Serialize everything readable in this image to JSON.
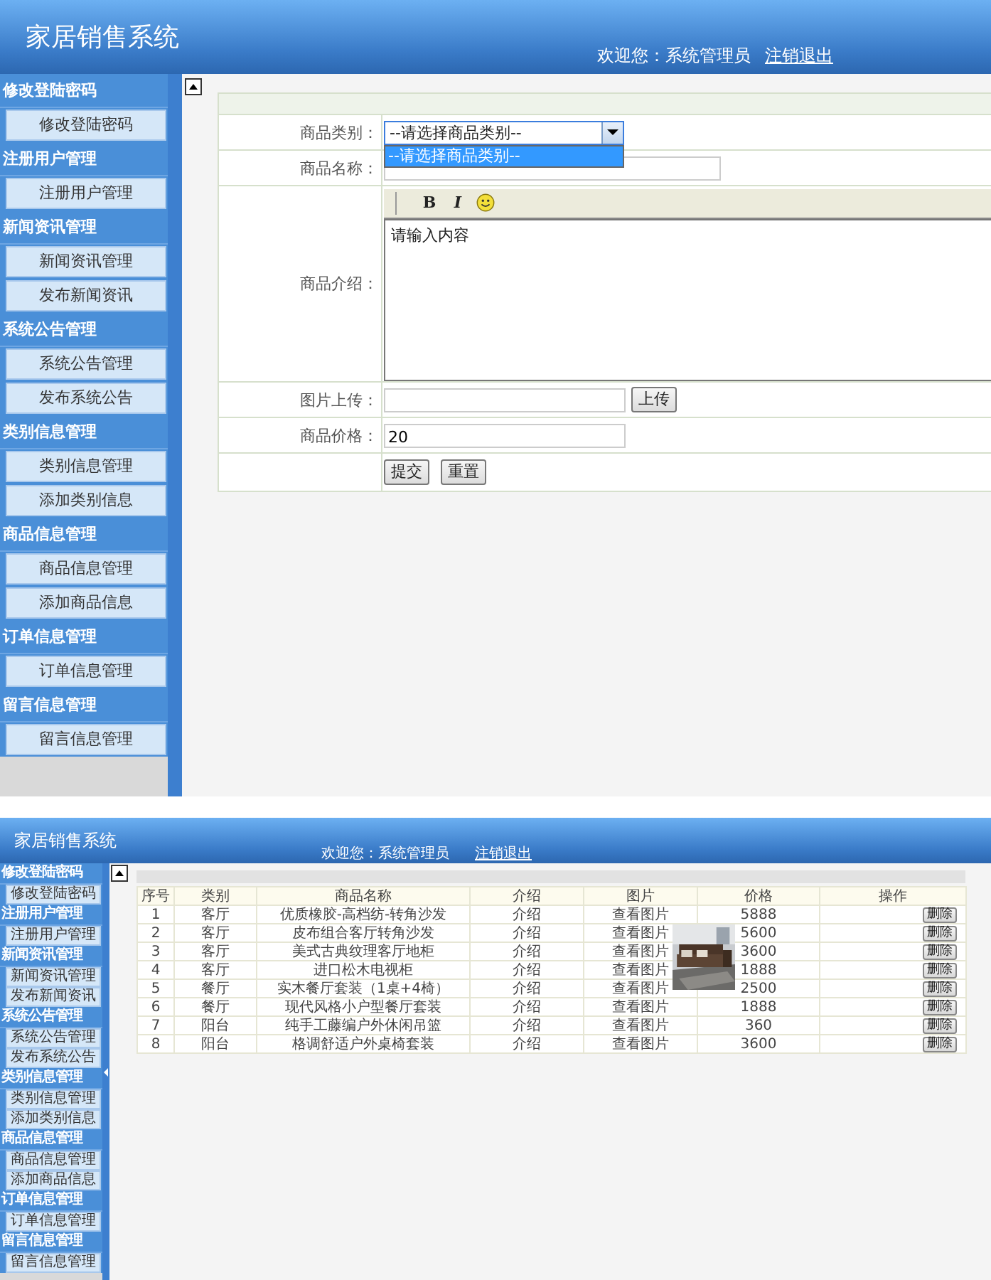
{
  "screens": [
    {
      "kind": "form",
      "header": {
        "title": "家居销售系统",
        "welcome": "欢迎您：系统管理员",
        "logout": "注销退出"
      },
      "sidebar": [
        {
          "title": "修改登陆密码",
          "items": [
            "修改登陆密码"
          ]
        },
        {
          "title": "注册用户管理",
          "items": [
            "注册用户管理"
          ]
        },
        {
          "title": "新闻资讯管理",
          "items": [
            "新闻资讯管理",
            "发布新闻资讯"
          ]
        },
        {
          "title": "系统公告管理",
          "items": [
            "系统公告管理",
            "发布系统公告"
          ]
        },
        {
          "title": "类别信息管理",
          "items": [
            "类别信息管理",
            "添加类别信息"
          ]
        },
        {
          "title": "商品信息管理",
          "items": [
            "商品信息管理",
            "添加商品信息"
          ]
        },
        {
          "title": "订单信息管理",
          "items": [
            "订单信息管理"
          ]
        },
        {
          "title": "留言信息管理",
          "items": [
            "留言信息管理"
          ]
        }
      ],
      "form": {
        "fields": [
          {
            "kind": "select",
            "label": "商品类别：",
            "value": "--请选择商品类别--",
            "expanded": true,
            "options": [
              {
                "label": "--请选择商品类别--",
                "selected": true
              }
            ]
          },
          {
            "kind": "text",
            "label": "商品名称："
          },
          {
            "kind": "editor",
            "label": "商品介绍：",
            "toolbar": [
              "B",
              "I"
            ],
            "value": "请输入内容"
          },
          {
            "kind": "upload",
            "label": "图片上传：",
            "button": "上传"
          },
          {
            "kind": "text",
            "label": "商品价格：",
            "value": "20"
          },
          {
            "kind": "actions",
            "buttons": [
              "提交",
              "重置"
            ]
          }
        ]
      }
    },
    {
      "kind": "list",
      "header": {
        "title": "家居销售系统",
        "welcome": "欢迎您：系统管理员",
        "logout": "注销退出"
      },
      "sidebar": [
        {
          "title": "修改登陆密码",
          "items": [
            "修改登陆密码"
          ]
        },
        {
          "title": "注册用户管理",
          "items": [
            "注册用户管理"
          ]
        },
        {
          "title": "新闻资讯管理",
          "items": [
            "新闻资讯管理",
            "发布新闻资讯"
          ]
        },
        {
          "title": "系统公告管理",
          "items": [
            "系统公告管理",
            "发布系统公告"
          ]
        },
        {
          "title": "类别信息管理",
          "items": [
            "类别信息管理",
            "添加类别信息"
          ]
        },
        {
          "title": "商品信息管理",
          "items": [
            "商品信息管理",
            "添加商品信息"
          ]
        },
        {
          "title": "订单信息管理",
          "items": [
            "订单信息管理"
          ]
        },
        {
          "title": "留言信息管理",
          "items": [
            "留言信息管理"
          ]
        }
      ],
      "table": {
        "columns": [
          "序号",
          "类别",
          "商品名称",
          "介绍",
          "图片",
          "价格",
          "操作"
        ],
        "rows": [
          {
            "cells": [
              "1",
              "客厅",
              "优质橡胶-高档纺-转角沙发",
              "介绍",
              "查看图片",
              "5888"
            ],
            "action": "删除"
          },
          {
            "cells": [
              "2",
              "客厅",
              "皮布组合客厅转角沙发",
              "介绍",
              "查看图片",
              "5600"
            ],
            "action": "删除"
          },
          {
            "cells": [
              "3",
              "客厅",
              "美式古典纹理客厅地柜",
              "介绍",
              "查看图片",
              "3600"
            ],
            "action": "删除"
          },
          {
            "cells": [
              "4",
              "客厅",
              "进口松木电视柜",
              "介绍",
              "查看图片",
              "1888"
            ],
            "action": "删除"
          },
          {
            "cells": [
              "5",
              "餐厅",
              "实木餐厅套装（1桌+4椅）",
              "介绍",
              "查看图片",
              "2500"
            ],
            "action": "删除"
          },
          {
            "cells": [
              "6",
              "餐厅",
              "现代风格小户型餐厅套装",
              "介绍",
              "查看图片",
              "1888"
            ],
            "action": "删除"
          },
          {
            "cells": [
              "7",
              "阳台",
              "纯手工藤编户外休闲吊篮",
              "介绍",
              "查看图片",
              "360"
            ],
            "action": "删除"
          },
          {
            "cells": [
              "8",
              "阳台",
              "格调舒适户外桌椅套装",
              "介绍",
              "查看图片",
              "3600"
            ],
            "action": "删除"
          }
        ]
      }
    }
  ]
}
